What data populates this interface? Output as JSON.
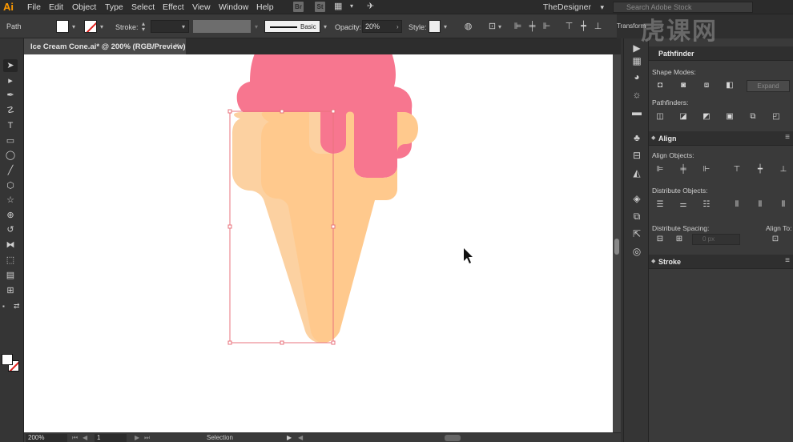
{
  "menubar": {
    "logo": "Ai",
    "items": [
      "File",
      "Edit",
      "Object",
      "Type",
      "Select",
      "Effect",
      "View",
      "Window",
      "Help"
    ],
    "bridge_br": "Br",
    "bridge_st": "St",
    "workspace": "TheDesigner",
    "search_placeholder": "Search Adobe Stock"
  },
  "controlbar": {
    "selection_type": "Path",
    "stroke_label": "Stroke:",
    "brush_label": "Basic",
    "opacity_label": "Opacity:",
    "opacity_value": "20%",
    "style_label": "Style:"
  },
  "document": {
    "tab_title": "Ice Cream Cone.ai* @ 200% (RGB/Preview)",
    "close_glyph": "×"
  },
  "statusbar": {
    "zoom": "200%",
    "page": "1",
    "status": "Selection"
  },
  "panels": {
    "transform_tab": "Transform",
    "pathfinder": {
      "title": "Pathfinder",
      "shape_modes_label": "Shape Modes:",
      "expand_label": "Expand",
      "pathfinders_label": "Pathfinders:"
    },
    "align": {
      "title": "Align",
      "align_objects_label": "Align Objects:",
      "distribute_objects_label": "Distribute Objects:",
      "distribute_spacing_label": "Distribute Spacing:",
      "spacing_value": "0 px",
      "align_to_label": "Align To:"
    },
    "stroke": {
      "title": "Stroke"
    }
  },
  "artwork": {
    "scoop_color": "#f7768f",
    "cone_color": "#ffc98d",
    "cone_shadow_color": "#fcd1a1",
    "selection_color": "#e8737c"
  },
  "watermark": "虎课网"
}
